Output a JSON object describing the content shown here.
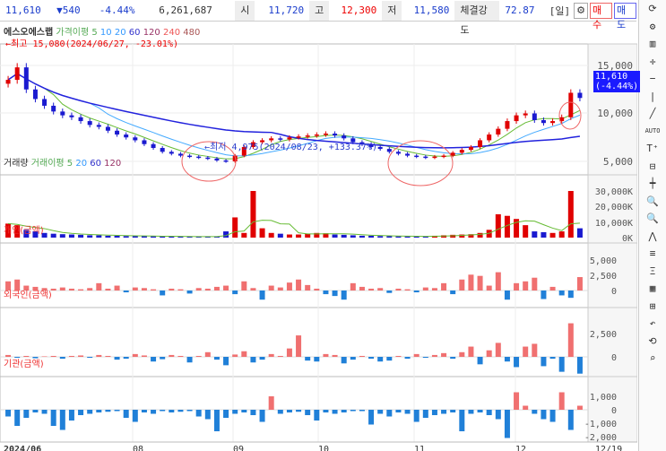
{
  "header": {
    "price": "11,610",
    "change": "▼540",
    "change_pct": "-4.44%",
    "volume": "6,261,687",
    "open_label": "시",
    "open": "11,720",
    "high_label": "고",
    "high": "12,300",
    "low_label": "저",
    "low": "11,580",
    "strength_label": "체결강도",
    "strength": "72.87",
    "period": "[일]",
    "buy": "매수",
    "sell": "매도"
  },
  "legend": {
    "name": "에스오에스랩",
    "ma": "가격이평 5",
    "ma_items": [
      "10",
      "20",
      "60",
      "120",
      "240",
      "480"
    ],
    "vol": "거래량",
    "vol_ma": "거래이평 5",
    "vol_items": [
      "20",
      "60",
      "120"
    ],
    "ind": "개인(금액)",
    "for": "외국인(금액)",
    "inst": "기관(금액)"
  },
  "annotations": {
    "high": "←최고 15,080(2024/06/27, -23.01%)",
    "low": "←최저 4,975(2024/08/23, +133.37%)",
    "price_tag": "11,610",
    "pct_tag": "(-4.44%)"
  },
  "colors": {
    "up": "#e00000",
    "down": "#1a1ad0",
    "pos": "#f07070",
    "neg": "#2080d8"
  },
  "chart_data": {
    "type": "candlestick",
    "x_labels": [
      "2024/06",
      "08",
      "09",
      "10",
      "11",
      "12",
      "12/19"
    ],
    "price_ticks": [
      "15,000",
      "10,000",
      "5,000"
    ],
    "volume_ticks": [
      "30,000K",
      "20,000K",
      "10,000K",
      "0K"
    ],
    "individual_ticks": [
      "5,000",
      "2,500",
      "0"
    ],
    "foreign_ticks": [
      "2,500",
      "0"
    ],
    "institution_ticks": [
      "1,000",
      "0",
      "-1,000",
      "-2,000"
    ],
    "close": [
      13500,
      14800,
      12500,
      11500,
      10800,
      10200,
      9800,
      9600,
      9200,
      8800,
      8600,
      8200,
      7800,
      7500,
      7200,
      6800,
      6400,
      6000,
      5800,
      5600,
      5500,
      5400,
      5300,
      5100,
      5000,
      5600,
      6500,
      7000,
      7200,
      7400,
      7300,
      7500,
      7600,
      7700,
      7800,
      7900,
      7700,
      7400,
      7000,
      6800,
      6500,
      6300,
      6000,
      5800,
      5600,
      5500,
      5400,
      5500,
      5600,
      5900,
      6200,
      6500,
      7200,
      7800,
      8400,
      9200,
      9800,
      10000,
      9300,
      9000,
      9200,
      9600,
      12150,
      11610
    ],
    "volume_k": [
      9000,
      8000,
      5000,
      4000,
      3000,
      2500,
      2200,
      2000,
      1800,
      1500,
      1500,
      1200,
      1200,
      1000,
      1000,
      900,
      800,
      800,
      700,
      700,
      600,
      600,
      600,
      700,
      4000,
      13000,
      3000,
      30000,
      6000,
      3000,
      2500,
      2000,
      2000,
      2500,
      3000,
      2800,
      2000,
      1800,
      1500,
      1200,
      1200,
      1000,
      900,
      800,
      800,
      700,
      700,
      1200,
      1500,
      1800,
      2000,
      2200,
      3000,
      5000,
      15000,
      14000,
      12000,
      8000,
      4000,
      3500,
      3000,
      4000,
      30000,
      6000
    ],
    "individual": [
      1500,
      1800,
      800,
      600,
      400,
      300,
      500,
      300,
      200,
      400,
      1200,
      300,
      800,
      -300,
      500,
      400,
      200,
      -800,
      300,
      200,
      -500,
      400,
      300,
      600,
      800,
      -600,
      1500,
      400,
      -1500,
      800,
      500,
      1300,
      1800,
      900,
      300,
      -600,
      -900,
      -1500,
      1200,
      600,
      300,
      400,
      -400,
      300,
      200,
      -300,
      500,
      400,
      1200,
      -600,
      1800,
      2600,
      2400,
      800,
      3000,
      -1500,
      1200,
      1500,
      2100,
      -1400,
      600,
      -800,
      -1200,
      2200
    ],
    "foreign": [
      200,
      -100,
      100,
      -150,
      50,
      100,
      -200,
      100,
      150,
      -100,
      200,
      100,
      -300,
      -200,
      300,
      150,
      -500,
      -250,
      200,
      100,
      -600,
      100,
      500,
      -300,
      -900,
      250,
      600,
      -600,
      -300,
      300,
      100,
      900,
      2300,
      -400,
      -500,
      300,
      200,
      -700,
      -300,
      100,
      -200,
      -500,
      -400,
      100,
      -200,
      300,
      -100,
      200,
      400,
      -200,
      500,
      1100,
      -800,
      700,
      1500,
      -500,
      -1100,
      1100,
      1400,
      -1000,
      -200,
      -1600,
      3600,
      -1800
    ],
    "institution": [
      -500,
      -1200,
      -600,
      -200,
      -300,
      -1200,
      -1500,
      -800,
      -400,
      -300,
      -200,
      -150,
      -100,
      -600,
      -900,
      -200,
      -300,
      -100,
      -200,
      -150,
      -100,
      -500,
      -700,
      -1600,
      -600,
      -300,
      -200,
      -400,
      -900,
      1000,
      -300,
      -200,
      -150,
      -400,
      -800,
      -200,
      -300,
      -200,
      -100,
      -100,
      -1100,
      -300,
      -500,
      -200,
      -300,
      -900,
      -600,
      -400,
      -300,
      -200,
      -1600,
      -300,
      -200,
      -400,
      -700,
      -2100,
      1300,
      300,
      -300,
      -700,
      -900,
      1300,
      -1500,
      300
    ]
  }
}
